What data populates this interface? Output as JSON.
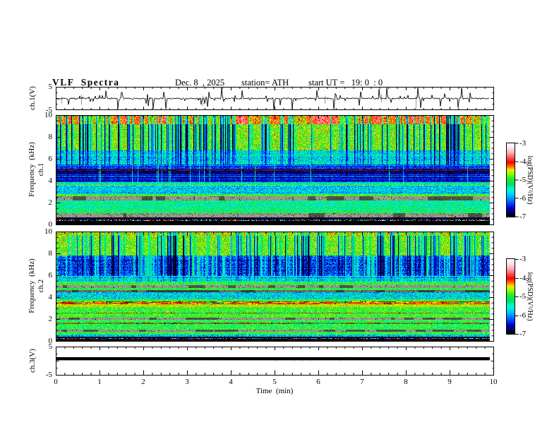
{
  "header": {
    "title": "VLF  Spectra",
    "date": "Dec. 8  , 2025",
    "station": "station= ATH",
    "start_ut": "start UT =   19: 0  : 0"
  },
  "time_axis": {
    "label": "Time  (min)",
    "min": 0,
    "max": 10,
    "tick_labels": [
      "0",
      "1",
      "2",
      "3",
      "4",
      "5",
      "6",
      "7",
      "8",
      "9",
      "10"
    ],
    "minor_per_major": 5
  },
  "panels": {
    "wave1": {
      "ylabel": "ch.1(V)",
      "ymin": -5,
      "ymax": 5,
      "ytick_labels": [
        "5",
        "-5"
      ]
    },
    "spec1": {
      "ylabel_channel": "ch.1",
      "ylabel_axis": "Frequency  (kHz)",
      "ymin": 0,
      "ymax": 10,
      "ytick_labels": [
        "10",
        "8",
        "6",
        "4",
        "2",
        "0"
      ]
    },
    "spec2": {
      "ylabel_channel": "ch.2",
      "ylabel_axis": "Frequency  (kHz)",
      "ymin": 0,
      "ymax": 10,
      "ytick_labels": [
        "10",
        "8",
        "6",
        "4",
        "2",
        "0"
      ]
    },
    "wave3": {
      "ylabel": "ch.3(V)",
      "ymin": -5,
      "ymax": 5,
      "ytick_labels": [
        "5",
        "-5"
      ]
    }
  },
  "colorbar": {
    "label": "log(PSD)(V²/Hz)",
    "tick_labels": [
      "-3",
      "-4",
      "-5",
      "-6",
      "-7"
    ],
    "value_range": [
      -7,
      -3
    ],
    "stops": [
      [
        0,
        "#ffffff"
      ],
      [
        0.06,
        "#ffe6ea"
      ],
      [
        0.13,
        "#ffaab4"
      ],
      [
        0.2,
        "#ff5050"
      ],
      [
        0.26,
        "#ff0000"
      ],
      [
        0.32,
        "#ff7700"
      ],
      [
        0.36,
        "#ffe000"
      ],
      [
        0.41,
        "#99ff00"
      ],
      [
        0.48,
        "#22ee22"
      ],
      [
        0.56,
        "#00dd77"
      ],
      [
        0.63,
        "#00ffcc"
      ],
      [
        0.69,
        "#00d5ff"
      ],
      [
        0.75,
        "#0099ff"
      ],
      [
        0.82,
        "#0044ff"
      ],
      [
        0.88,
        "#0000cc"
      ],
      [
        0.94,
        "#000066"
      ],
      [
        1,
        "#000000"
      ]
    ]
  },
  "chart_data": [
    {
      "type": "line",
      "name": "ch1_waveform",
      "ylabel": "ch.1(V)",
      "x_range_min": [
        0,
        10
      ],
      "y_range_V": [
        -5,
        5
      ],
      "baseline_V": 0,
      "noise_rms_V": 0.4,
      "spike_count": 34,
      "spike_amp_V": [
        1.5,
        5
      ],
      "spike_down_fraction": 0.62,
      "seed": 55,
      "summary": "broadband VLF noise around 0 V with impulsive sferic spikes reaching about ±5 V"
    },
    {
      "type": "heatmap",
      "name": "ch1_spectrogram",
      "x_range_min": [
        0,
        10
      ],
      "y_range_kHz": [
        0,
        10
      ],
      "z_log_psd_range": [
        -7,
        -3
      ],
      "seed": 1234,
      "fleck": 0.01,
      "bands": [
        {
          "f": [
            10,
            9.2
          ],
          "v": -4.5,
          "n": 0.5,
          "hot": 0.9
        },
        {
          "f": [
            9.2,
            6.8
          ],
          "v": -4.75,
          "n": 0.5,
          "fleck": 0.01
        },
        {
          "f": [
            6.8,
            5.5
          ],
          "v": -5.6,
          "n": 0.55,
          "hs": 0.2
        },
        {
          "f": [
            5.5,
            5.06
          ],
          "v": -6.3,
          "n": 0.35,
          "hs": 0.35
        },
        {
          "f": [
            5.06,
            4.96
          ],
          "type": "palette",
          "colors": [
            "#701000",
            "#8a1a00",
            "#400a00",
            "#222266"
          ]
        },
        {
          "f": [
            4.96,
            3.9
          ],
          "v": -6.45,
          "n": 0.3,
          "hs": 0.35
        },
        {
          "f": [
            3.9,
            3.66
          ],
          "v": -5.5,
          "n": 0.5
        },
        {
          "f": [
            3.66,
            3.56
          ],
          "v": -4.75,
          "n": 0.3
        },
        {
          "f": [
            3.56,
            2.82
          ],
          "v": -5.8,
          "n": 0.5,
          "hs": 0.15
        },
        {
          "f": [
            2.82,
            2.62
          ],
          "v": -4.9,
          "n": 0.3
        },
        {
          "f": [
            2.62,
            2.2
          ],
          "type": "grey"
        },
        {
          "f": [
            2.2,
            1.35
          ],
          "v": -5.35,
          "n": 0.5
        },
        {
          "f": [
            1.35,
            1.02
          ],
          "v": -5.15,
          "n": 0.4
        },
        {
          "f": [
            1.02,
            0.62
          ],
          "type": "grey"
        },
        {
          "f": [
            0.62,
            0.44
          ],
          "v": -6.9,
          "n": 0.12
        },
        {
          "f": [
            0.44,
            0.3
          ],
          "type": "speckle"
        },
        {
          "f": [
            0.3,
            0
          ],
          "v": -7,
          "n": 0.04
        }
      ],
      "dark_streak_zones": [
        [
          9.2,
          10,
          0.6
        ],
        [
          6.8,
          9.2,
          1.0
        ],
        [
          5.5,
          6.8,
          0.6
        ],
        [
          3.9,
          5.5,
          0.18
        ]
      ],
      "light_streak_zones": [
        [
          3.9,
          6.8,
          0.8
        ],
        [
          1.3,
          3.9,
          0.3
        ]
      ],
      "green_column_zones": [],
      "speckle_colors": [
        "#ff2200",
        "#ffaa00",
        "#22ee22",
        "#00ffcc",
        "#2255ff",
        "#ffffff",
        "#cc44ff"
      ],
      "summary": "green/yellow sferic band 7-10 kHz with dense dark vertical impulses, dark blue 4-6.5 kHz band with horizontal line structure, grey interference bands near 2.4 and 0.8 kHz, black below 0.3 kHz"
    },
    {
      "type": "heatmap",
      "name": "ch2_spectrogram",
      "x_range_min": [
        0,
        10
      ],
      "y_range_kHz": [
        0,
        10
      ],
      "z_log_psd_range": [
        -7,
        -3
      ],
      "seed": 987,
      "bands": [
        {
          "f": [
            10,
            9.65
          ],
          "v": -4.55,
          "n": 0.45
        },
        {
          "f": [
            9.65,
            7.85
          ],
          "v": -4.78,
          "n": 0.5,
          "fleck": 0.008
        },
        {
          "f": [
            7.85,
            6.0
          ],
          "v": -6.3,
          "n": 0.5,
          "hs": 0.2
        },
        {
          "f": [
            6.0,
            5.45
          ],
          "v": -5.85,
          "n": 0.45,
          "hs": 0.5
        },
        {
          "f": [
            5.45,
            5.12
          ],
          "v": -5.0,
          "n": 0.4
        },
        {
          "f": [
            5.12,
            4.85
          ],
          "type": "grey"
        },
        {
          "f": [
            4.85,
            4.7
          ],
          "v": -5.05,
          "n": 0.4
        },
        {
          "f": [
            4.7,
            4.5
          ],
          "type": "grey-dark"
        },
        {
          "f": [
            4.5,
            3.82
          ],
          "v": -5.7,
          "n": 0.55,
          "hs": 0.2
        },
        {
          "f": [
            3.82,
            3.62
          ],
          "v": -4.95,
          "n": 0.4
        },
        {
          "f": [
            3.62,
            3.36
          ],
          "type": "palette",
          "colors": [
            "#ff2a00",
            "#e64400",
            "#992000",
            "#ff8800",
            "#ffdd00",
            "#30bb44"
          ]
        },
        {
          "f": [
            3.36,
            3.14
          ],
          "v": -4.55,
          "n": 0.3
        },
        {
          "f": [
            3.14,
            2.62
          ],
          "v": -4.95,
          "n": 0.4
        },
        {
          "f": [
            2.62,
            2.5
          ],
          "type": "palette",
          "colors": [
            "#dd5500",
            "#b34400",
            "#33bb44",
            "#2aa866",
            "#777755"
          ]
        },
        {
          "f": [
            2.5,
            2.15
          ],
          "v": -4.9,
          "n": 0.4
        },
        {
          "f": [
            2.15,
            1.98
          ],
          "type": "grey"
        },
        {
          "f": [
            1.98,
            1.66
          ],
          "v": -5.05,
          "n": 0.45
        },
        {
          "f": [
            1.66,
            1.56
          ],
          "type": "palette",
          "colors": [
            "#cc5500",
            "#aa4400",
            "#33bb44",
            "#2aa866"
          ]
        },
        {
          "f": [
            1.56,
            1.05
          ],
          "v": -5.05,
          "n": 0.45
        },
        {
          "f": [
            1.05,
            0.86
          ],
          "type": "grey"
        },
        {
          "f": [
            0.86,
            0.6
          ],
          "v": -5.0,
          "n": 0.4
        },
        {
          "f": [
            0.6,
            0.4
          ],
          "v": -5.8,
          "n": 0.5
        },
        {
          "f": [
            0.4,
            0.26
          ],
          "v": -6.85,
          "n": 0.15
        },
        {
          "f": [
            0.26,
            0.18
          ],
          "type": "speckle"
        },
        {
          "f": [
            0.18,
            0.1
          ],
          "v": -7,
          "n": 0.05
        },
        {
          "f": [
            0.1,
            0.04
          ],
          "type": "palette",
          "colors": [
            "#661111",
            "#7a1500",
            "#330808",
            "#000000"
          ]
        },
        {
          "f": [
            0.04,
            0
          ],
          "v": -7,
          "n": 0.03
        }
      ],
      "dark_streak_zones": [
        [
          9.65,
          10,
          0.5
        ],
        [
          7.85,
          9.65,
          1.0
        ],
        [
          6.0,
          7.85,
          0.9
        ],
        [
          5.45,
          6.0,
          0.3
        ]
      ],
      "light_streak_zones": [
        [
          4.5,
          6.0,
          0.5
        ]
      ],
      "green_column_zones": [
        [
          6.0,
          9.65,
          1.0
        ]
      ],
      "speckle_colors": [
        "#ff2200",
        "#ffaa00",
        "#22ee22",
        "#00ffcc",
        "#2255ff",
        "#ffffff",
        "#cc44ff"
      ],
      "summary": "green sferic band 8-10 kHz, dark blue 6-8 kHz impulse band, strong red PSD line near 3.5 kHz, orange dashed lines near 2.55 and 1.6 kHz, grey interference bands near 5, 4.6, 2.05, 0.95 kHz, black below 0.25 kHz"
    },
    {
      "type": "line",
      "name": "ch3_waveform",
      "ylabel": "ch.3(V)",
      "x_range_min": [
        0,
        10
      ],
      "y_range_V": [
        -5,
        5
      ],
      "value_V": 0,
      "line_thickness_V": 1,
      "seed": 7,
      "summary": "flat constant 0 V thick black trace (channel off / saturated)"
    }
  ]
}
